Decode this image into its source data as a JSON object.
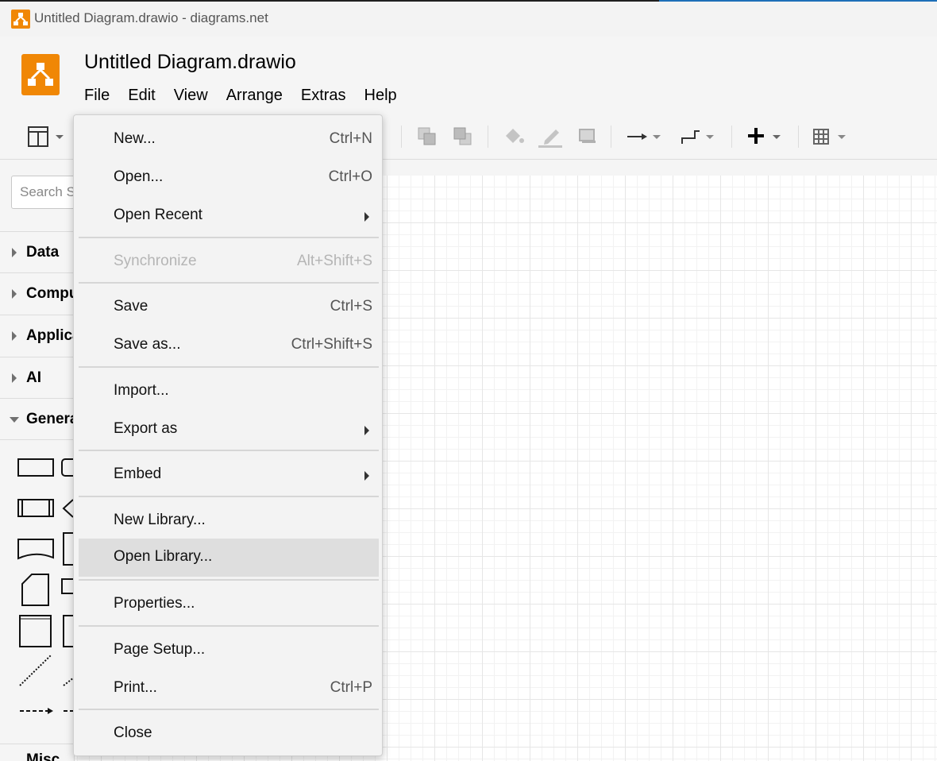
{
  "window": {
    "title": "Untitled Diagram.drawio - diagrams.net"
  },
  "header": {
    "doc_title": "Untitled Diagram.drawio",
    "menus": [
      "File",
      "Edit",
      "View",
      "Arrange",
      "Extras",
      "Help"
    ]
  },
  "sidebar": {
    "search_placeholder": "Search Shapes",
    "categories": [
      {
        "label": "Data",
        "expanded": false
      },
      {
        "label": "Computer",
        "expanded": false
      },
      {
        "label": "Application",
        "expanded": false
      },
      {
        "label": "AI",
        "expanded": false
      },
      {
        "label": "General",
        "expanded": true
      },
      {
        "label": "Misc",
        "expanded": false
      }
    ]
  },
  "file_menu": {
    "items": [
      {
        "label": "New...",
        "shortcut": "Ctrl+N"
      },
      {
        "label": "Open...",
        "shortcut": "Ctrl+O"
      },
      {
        "label": "Open Recent",
        "submenu": true
      },
      {
        "label": "Synchronize",
        "shortcut": "Alt+Shift+S",
        "disabled": true
      },
      {
        "label": "Save",
        "shortcut": "Ctrl+S"
      },
      {
        "label": "Save as...",
        "shortcut": "Ctrl+Shift+S"
      },
      {
        "label": "Import..."
      },
      {
        "label": "Export as",
        "submenu": true
      },
      {
        "label": "Embed",
        "submenu": true
      },
      {
        "label": "New Library..."
      },
      {
        "label": "Open Library...",
        "highlighted": true
      },
      {
        "label": "Properties..."
      },
      {
        "label": "Page Setup..."
      },
      {
        "label": "Print...",
        "shortcut": "Ctrl+P"
      },
      {
        "label": "Close"
      }
    ]
  },
  "colors": {
    "brand": "#f08705",
    "menu_bg": "#f3f3f3",
    "highlight": "#dedede"
  }
}
